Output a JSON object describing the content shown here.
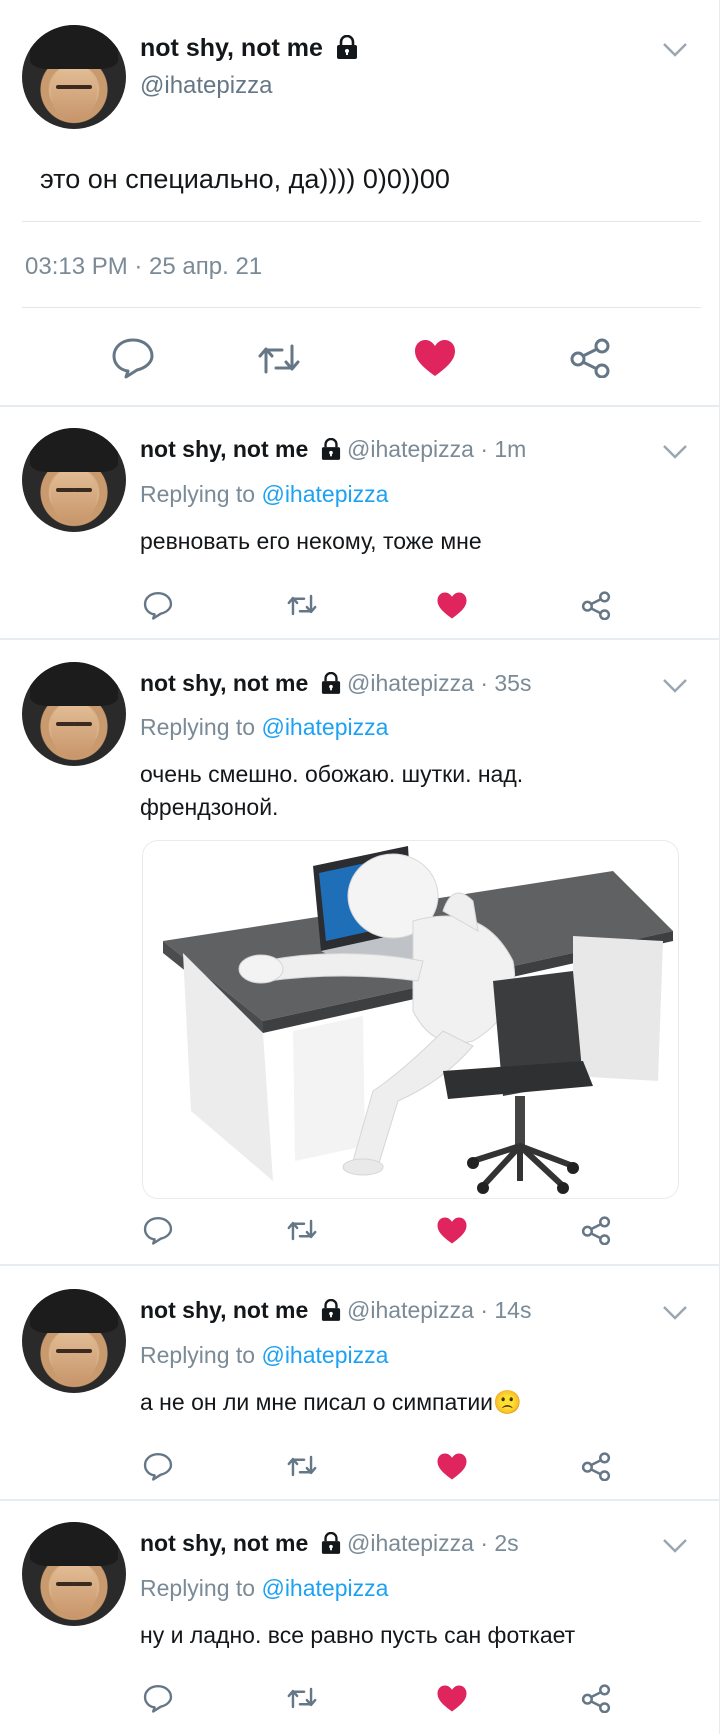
{
  "main_tweet": {
    "name": "not shy, not me",
    "handle": "@ihatepizza",
    "text": "это он специально, да)))) 0)0))00",
    "timestamp": "03:13 PM · 25 апр. 21"
  },
  "replies": [
    {
      "name": "not shy, not me",
      "handle_time": "@ihatepizza · 1m",
      "replying_prefix": "Replying to ",
      "replying_to": "@ihatepizza",
      "text": "ревновать его некому, тоже мне"
    },
    {
      "name": "not shy, not me",
      "handle_time": "@ihatepizza · 35s",
      "replying_prefix": "Replying to ",
      "replying_to": "@ihatepizza",
      "text_line1": "очень смешно. обожаю. шутки. над.",
      "text_line2": "френдзоной."
    },
    {
      "name": "not shy, not me",
      "handle_time": "@ihatepizza · 14s",
      "replying_prefix": "Replying to ",
      "replying_to": "@ihatepizza",
      "text": "а не он ли мне писал о симпатии🙁"
    },
    {
      "name": "not shy, not me",
      "handle_time": "@ihatepizza · 2s",
      "replying_prefix": "Replying to ",
      "replying_to": "@ihatepizza",
      "text": "ну и ладно. все равно пусть сан фоткает"
    }
  ],
  "icons": {
    "reply": "reply-icon",
    "retweet": "retweet-icon",
    "like": "heart-icon",
    "share": "share-icon",
    "lock": "lock-icon",
    "menu": "chevron-down-icon"
  },
  "colors": {
    "like_red": "#e0245e",
    "link_blue": "#1da1f2",
    "muted": "#657786"
  }
}
